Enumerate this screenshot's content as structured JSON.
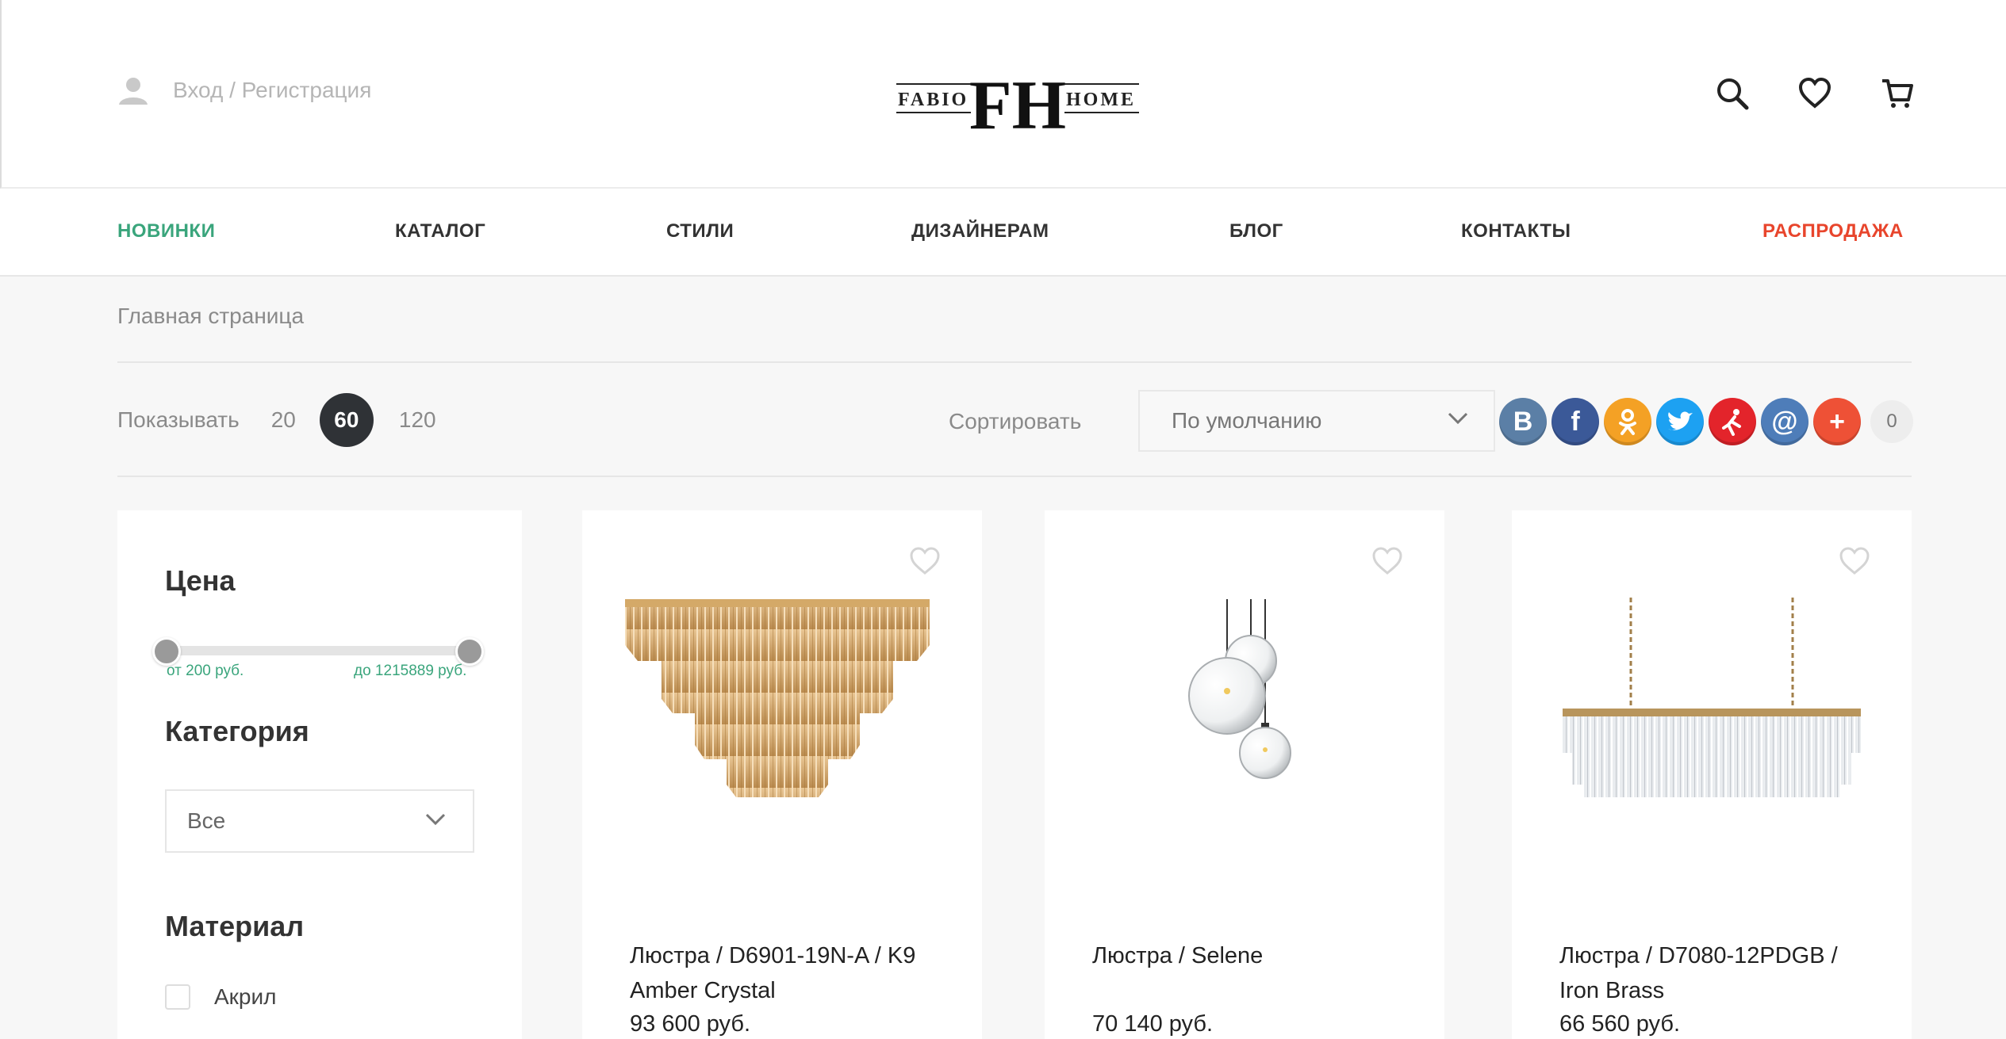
{
  "header": {
    "login_label": "Вход / Регистрация",
    "logo": {
      "left": "FABIO",
      "right": "HOME",
      "mark": "FH"
    }
  },
  "nav": {
    "items": [
      "НОВИНКИ",
      "КАТАЛОГ",
      "СТИЛИ",
      "ДИЗАЙНЕРАМ",
      "БЛОГ",
      "КОНТАКТЫ",
      "РАСПРОДАЖА"
    ]
  },
  "breadcrumb": "Главная страница",
  "toolbar": {
    "show_label": "Показывать",
    "show_options": [
      "20",
      "60",
      "120"
    ],
    "show_selected": "60",
    "sort_label": "Сортировать",
    "sort_value": "По умолчанию",
    "share_count": "0",
    "share_icons": [
      "vk-icon",
      "facebook-icon",
      "odnoklassniki-icon",
      "twitter-icon",
      "moimir-icon",
      "mailru-icon",
      "more-icon"
    ]
  },
  "filters": {
    "price_title": "Цена",
    "price_from": "от 200 руб.",
    "price_to": "до 1215889 руб.",
    "category_title": "Категория",
    "category_value": "Все",
    "material_title": "Материал",
    "materials": [
      "Акрил"
    ]
  },
  "products": [
    {
      "name": "Люстра / D6901-19N-A / K9 Amber Crystal",
      "price": "93 600 руб."
    },
    {
      "name": "Люстра / Selene",
      "price": "70 140 руб."
    },
    {
      "name": "Люстра / D7080-12PDGB / Iron Brass",
      "price": "66 560 руб."
    }
  ],
  "colors": {
    "accent_green": "#3aa57c",
    "sale_red": "#e8452c",
    "dark": "#2f3236"
  }
}
